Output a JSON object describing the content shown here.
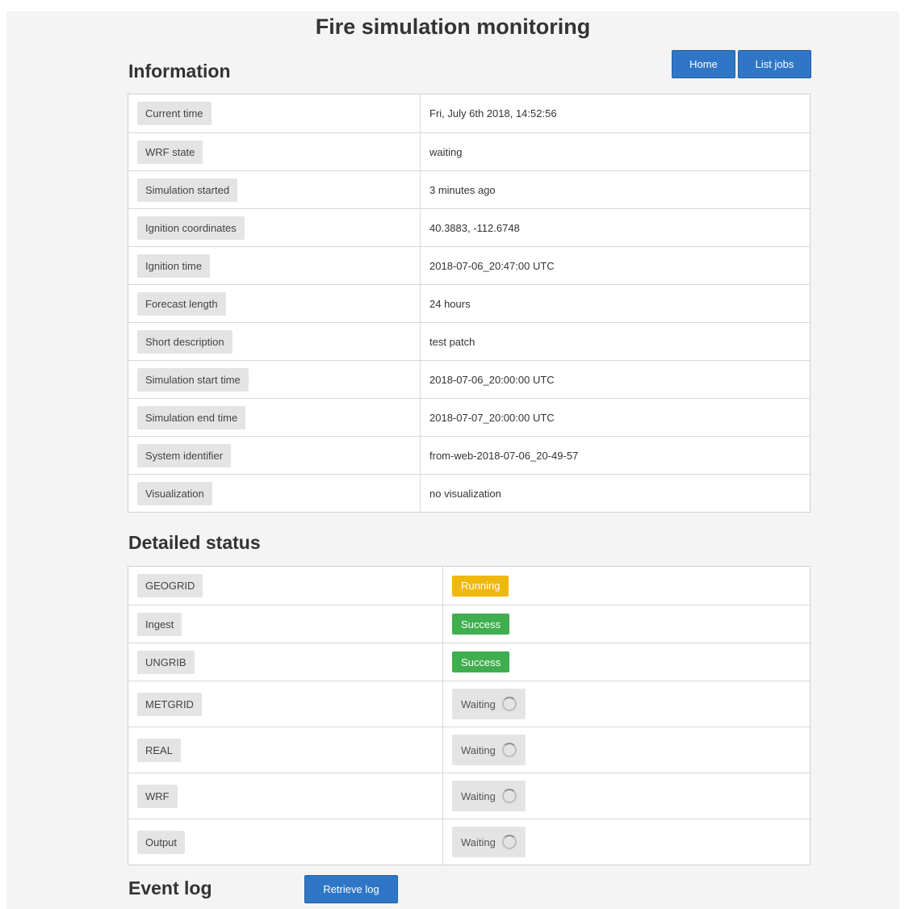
{
  "header": {
    "title": "Fire simulation monitoring"
  },
  "nav": {
    "home_label": "Home",
    "list_jobs_label": "List jobs"
  },
  "information": {
    "heading": "Information",
    "rows": [
      {
        "label": "Current time",
        "value": "Fri, July 6th 2018, 14:52:56"
      },
      {
        "label": "WRF state",
        "value": "waiting"
      },
      {
        "label": "Simulation started",
        "value": "3 minutes ago"
      },
      {
        "label": "Ignition coordinates",
        "value": "40.3883, -112.6748"
      },
      {
        "label": "Ignition time",
        "value": "2018-07-06_20:47:00 UTC"
      },
      {
        "label": "Forecast length",
        "value": "24 hours"
      },
      {
        "label": "Short description",
        "value": "test patch"
      },
      {
        "label": "Simulation start time",
        "value": "2018-07-06_20:00:00 UTC"
      },
      {
        "label": "Simulation end time",
        "value": "2018-07-07_20:00:00 UTC"
      },
      {
        "label": "System identifier",
        "value": "from-web-2018-07-06_20-49-57"
      },
      {
        "label": "Visualization",
        "value": "no visualization"
      }
    ]
  },
  "detailed_status": {
    "heading": "Detailed status",
    "rows": [
      {
        "label": "GEOGRID",
        "status": "Running"
      },
      {
        "label": "Ingest",
        "status": "Success"
      },
      {
        "label": "UNGRIB",
        "status": "Success"
      },
      {
        "label": "METGRID",
        "status": "Waiting"
      },
      {
        "label": "REAL",
        "status": "Waiting"
      },
      {
        "label": "WRF",
        "status": "Waiting"
      },
      {
        "label": "Output",
        "status": "Waiting"
      }
    ]
  },
  "event_log": {
    "heading": "Event log",
    "retrieve_label": "Retrieve log"
  },
  "colors": {
    "primary_button": "#2f77c6",
    "running": "#f0b70e",
    "success": "#3fae4f",
    "waiting": "#e4e4e4"
  }
}
